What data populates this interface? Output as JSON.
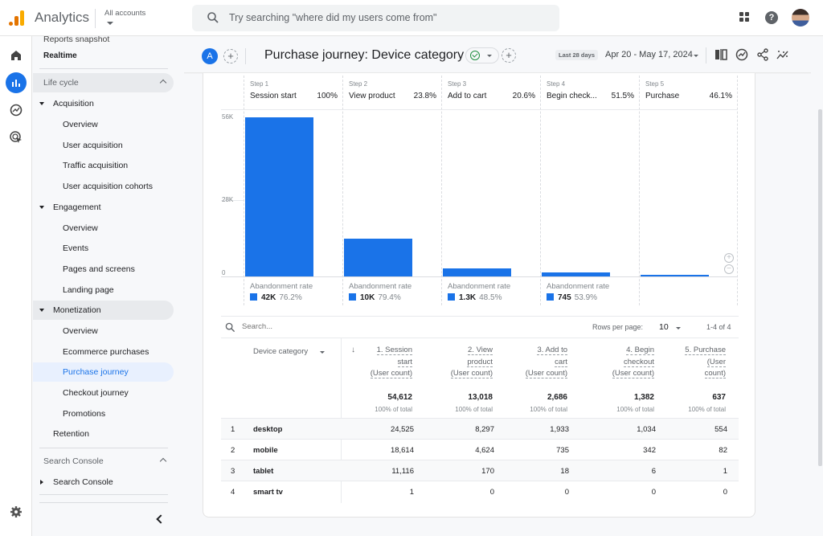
{
  "app": {
    "title": "Analytics",
    "accounts_label": "All accounts",
    "search_placeholder": "Try searching \"where did my users come from\"",
    "icons": [
      "apps-icon",
      "help-icon",
      "avatar"
    ]
  },
  "rail": {
    "items": [
      "home-icon",
      "reports-icon",
      "explore-icon",
      "advertising-icon"
    ],
    "bottom": "settings-icon"
  },
  "nav": {
    "partial_top": "Reports snapshot",
    "realtime": "Realtime",
    "section_lifecycle": "Life cycle",
    "acquisition": {
      "label": "Acquisition",
      "items": [
        "Overview",
        "User acquisition",
        "Traffic acquisition",
        "User acquisition cohorts"
      ]
    },
    "engagement": {
      "label": "Engagement",
      "items": [
        "Overview",
        "Events",
        "Pages and screens",
        "Landing page"
      ]
    },
    "monetization": {
      "label": "Monetization",
      "items": [
        "Overview",
        "Ecommerce purchases",
        "Purchase journey",
        "Checkout journey",
        "Promotions"
      ],
      "active": "Purchase journey"
    },
    "retention": "Retention",
    "section_search_console": "Search Console",
    "search_console": "Search Console"
  },
  "report": {
    "comparison_badge": "A",
    "title": "Purchase journey: Device category",
    "date_chip": "Last 28 days",
    "date_range": "Apr 20 - May 17, 2024",
    "toolbar_icons": [
      "compare-icon",
      "insights-icon",
      "share-icon",
      "trend-icon"
    ]
  },
  "chart_data": {
    "type": "bar",
    "title": "Purchase journey",
    "categories": [
      "Session start",
      "View product",
      "Add to cart",
      "Begin check...",
      "Purchase"
    ],
    "steps": [
      "Step 1",
      "Step 2",
      "Step 3",
      "Step 4",
      "Step 5"
    ],
    "completion_rates": [
      "100%",
      "23.8%",
      "20.6%",
      "51.5%",
      "46.1%"
    ],
    "values": [
      54612,
      13018,
      2686,
      1382,
      637
    ],
    "ylim": [
      0,
      56000
    ],
    "yticks": [
      "0",
      "28K",
      "56K"
    ],
    "abandonment": [
      {
        "label": "Abandonment rate",
        "count": "42K",
        "rate": "76.2%"
      },
      {
        "label": "Abandonment rate",
        "count": "10K",
        "rate": "79.4%"
      },
      {
        "label": "Abandonment rate",
        "count": "1.3K",
        "rate": "48.5%"
      },
      {
        "label": "Abandonment rate",
        "count": "745",
        "rate": "53.9%"
      }
    ],
    "bar_color": "#1a73e8",
    "grid": true
  },
  "table": {
    "search_placeholder": "Search...",
    "rows_per_page_label": "Rows per page:",
    "rows_per_page": "10",
    "pagination": "1-4 of 4",
    "dimension_header": "Device category",
    "columns": [
      {
        "l1": "1. Session",
        "l2": "start",
        "l3": "(User count)"
      },
      {
        "l1": "2. View",
        "l2": "product",
        "l3": "(User count)"
      },
      {
        "l1": "3. Add to",
        "l2": "cart",
        "l3": "(User count)"
      },
      {
        "l1": "4. Begin",
        "l2": "checkout",
        "l3": "(User count)"
      },
      {
        "l1": "5. Purchase",
        "l2": "(User",
        "l3": "count)"
      }
    ],
    "totals": [
      "54,612",
      "13,018",
      "2,686",
      "1,382",
      "637"
    ],
    "totals_pct": [
      "100% of total",
      "100% of total",
      "100% of total",
      "100% of total",
      "100% of total"
    ],
    "rows": [
      {
        "idx": "1",
        "dim": "desktop",
        "vals": [
          "24,525",
          "8,297",
          "1,933",
          "1,034",
          "554"
        ]
      },
      {
        "idx": "2",
        "dim": "mobile",
        "vals": [
          "18,614",
          "4,624",
          "735",
          "342",
          "82"
        ]
      },
      {
        "idx": "3",
        "dim": "tablet",
        "vals": [
          "11,116",
          "170",
          "18",
          "6",
          "1"
        ]
      },
      {
        "idx": "4",
        "dim": "smart tv",
        "vals": [
          "1",
          "0",
          "0",
          "0",
          "0"
        ]
      }
    ]
  },
  "colors": {
    "accent": "#1a73e8",
    "active_nav_bg": "#e8f0fe",
    "success": "#1e8e3e"
  }
}
